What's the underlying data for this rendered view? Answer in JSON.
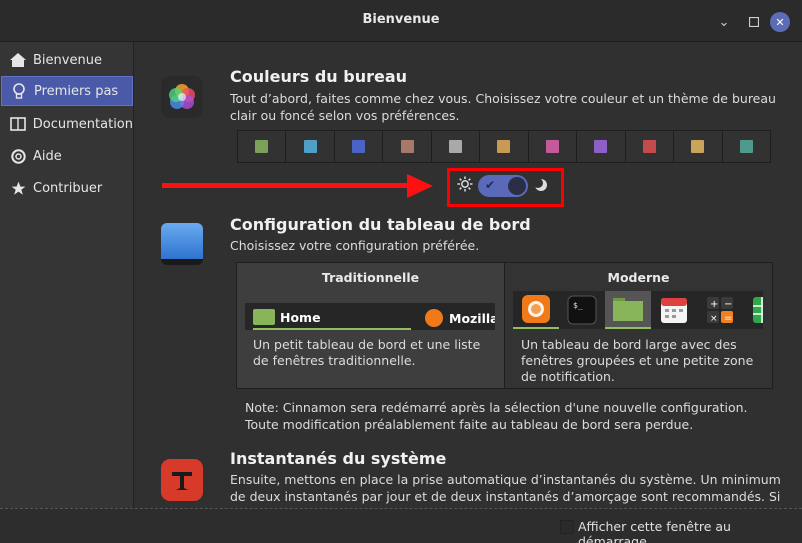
{
  "window": {
    "title": "Bienvenue"
  },
  "sidebar": {
    "items": [
      {
        "label": "Bienvenue",
        "icon": "home-icon"
      },
      {
        "label": "Premiers pas",
        "icon": "lightbulb-icon",
        "active": true
      },
      {
        "label": "Documentation",
        "icon": "book-icon"
      },
      {
        "label": "Aide",
        "icon": "lifebuoy-icon"
      },
      {
        "label": "Contribuer",
        "icon": "star-icon"
      }
    ]
  },
  "colors_section": {
    "title": "Couleurs du bureau",
    "text": "Tout d’abord, faites comme chez vous. Choisissez votre couleur et un thème de bureau clair ou foncé selon vos préférences.",
    "swatches": [
      "#7aa05a",
      "#4f9fc8",
      "#4a63c4",
      "#a8796a",
      "#a9a9a9",
      "#c99a55",
      "#c35b9a",
      "#8d5fc7",
      "#c44b4b",
      "#c9a55a",
      "#4e9a8c"
    ],
    "dark_mode": true
  },
  "panel_section": {
    "title": "Configuration du tableau de bord",
    "text": "Choisissez votre configuration préférée.",
    "traditional": {
      "name": "Traditionnelle",
      "desc": "Un petit tableau de bord et une liste de fenêtres traditionnelle.",
      "home_label": "Home",
      "moz_label": "Mozilla"
    },
    "modern": {
      "name": "Moderne",
      "desc": "Un tableau de bord large avec des fenêtres groupées et une petite zone de notification."
    },
    "note": "Note: Cinnamon sera redémarré après la sélection d'une nouvelle configuration. Toute modification préalablement faite au tableau de bord sera perdue."
  },
  "snapshots_section": {
    "title": "Instantanés du système",
    "text": "Ensuite, mettons en place la prise automatique d’instantanés du système. Un minimum de deux instantanés par jour et de deux instantanés d’amorçage sont recommandés. Si"
  },
  "footer": {
    "startup_label": "Afficher cette fenêtre au démarrage"
  }
}
